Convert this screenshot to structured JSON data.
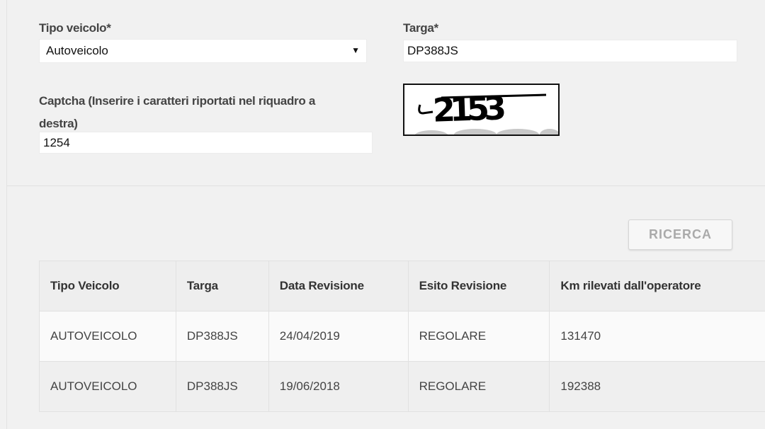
{
  "form": {
    "vehicle_type_label": "Tipo veicolo*",
    "vehicle_type_value": "Autoveicolo",
    "plate_label": "Targa*",
    "plate_value": "DP388JS",
    "captcha_label_line1": "Captcha (Inserire i caratteri riportati nel riquadro a",
    "captcha_label_line2": "destra)",
    "captcha_value": "1254",
    "captcha_image_text": "2153"
  },
  "search_button_label": "RICERCA",
  "results_table": {
    "columns": [
      "Tipo Veicolo",
      "Targa",
      "Data Revisione",
      "Esito Revisione",
      "Km rilevati dall'operatore"
    ],
    "rows": [
      [
        "AUTOVEICOLO",
        "DP388JS",
        "24/04/2019",
        "REGOLARE",
        "131470"
      ],
      [
        "AUTOVEICOLO",
        "DP388JS",
        "19/06/2018",
        "REGOLARE",
        "192388"
      ]
    ]
  },
  "colors": {
    "background": "#f1f1f1",
    "button_text": "#aaaaaa",
    "field_background": "#ffffff"
  }
}
